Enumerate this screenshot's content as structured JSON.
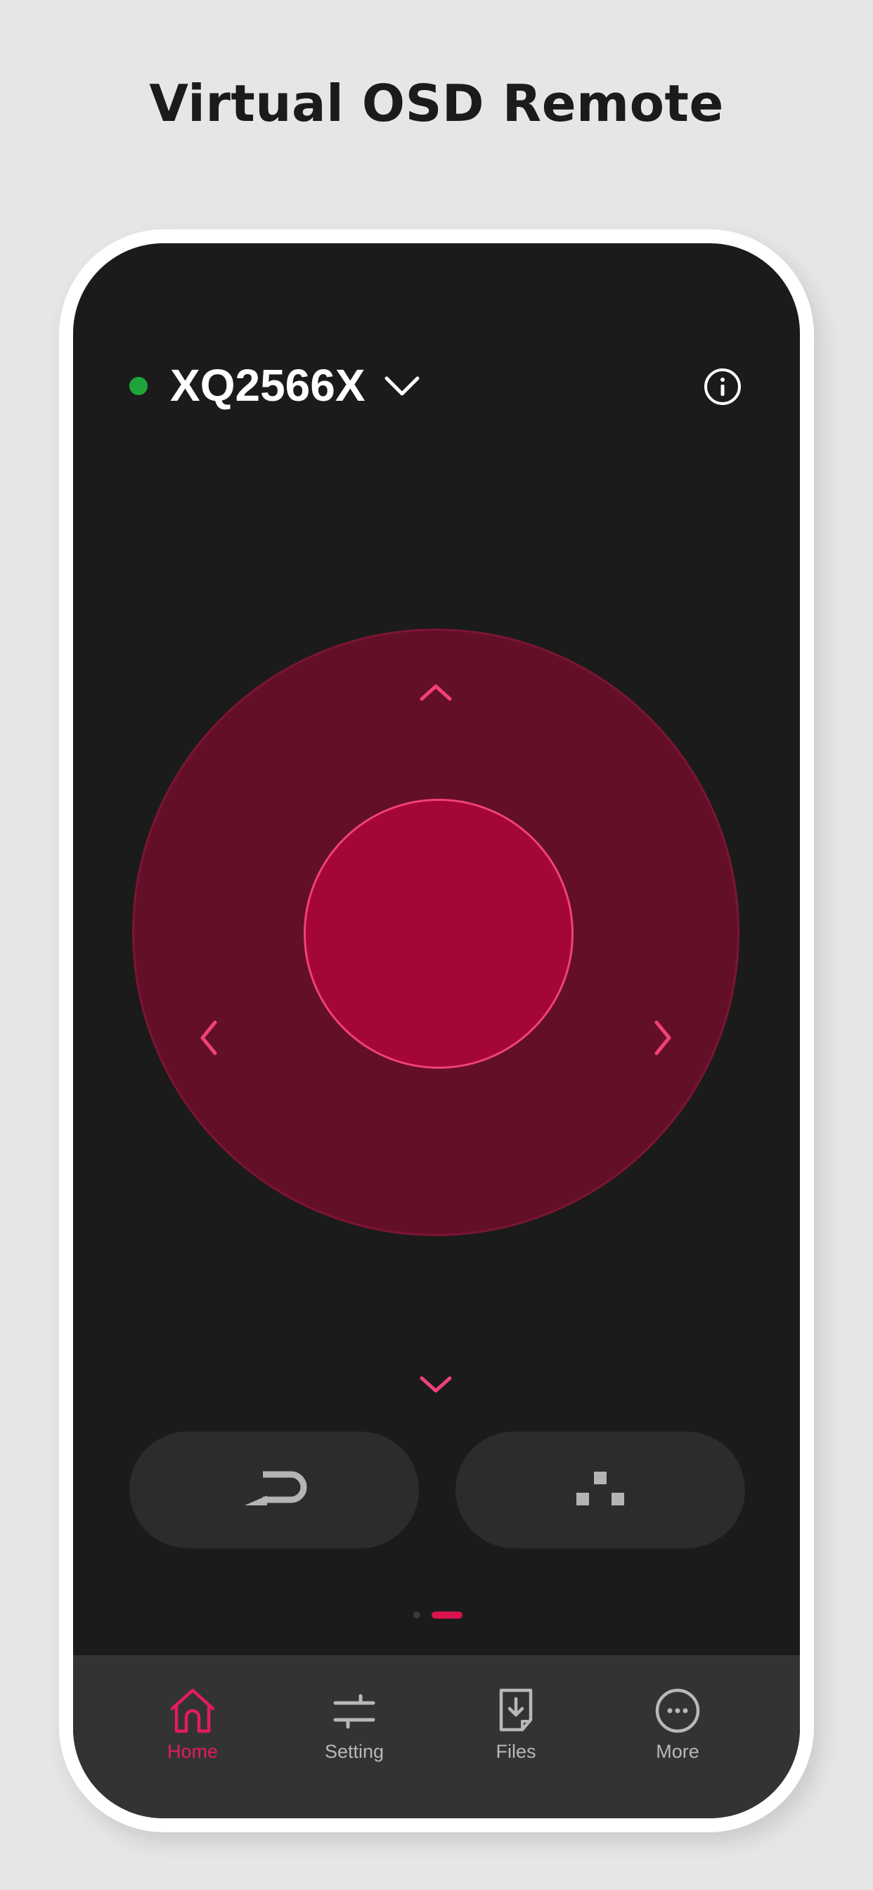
{
  "headline": "Virtual OSD Remote",
  "header": {
    "device_name": "XQ2566X",
    "status_color": "#1ea53a",
    "dropdown_icon": "chevron-down-icon",
    "info_icon": "info-icon"
  },
  "dpad": {
    "up_icon": "chevron-up-icon",
    "down_icon": "chevron-down-icon",
    "left_icon": "chevron-left-icon",
    "right_icon": "chevron-right-icon",
    "accent_color": "#f0407a"
  },
  "controls": {
    "back_icon": "return-icon",
    "menu_icon": "dots-menu-icon"
  },
  "pager": {
    "count": 2,
    "active": 2
  },
  "bottom_nav": {
    "items": [
      {
        "label": "Home",
        "icon": "home-icon",
        "active": true
      },
      {
        "label": "Setting",
        "icon": "sliders-icon",
        "active": false
      },
      {
        "label": "Files",
        "icon": "file-download-icon",
        "active": false
      },
      {
        "label": "More",
        "icon": "more-icon",
        "active": false
      }
    ],
    "active_color": "#e41c5a",
    "inactive_color": "#b8b8b8"
  }
}
